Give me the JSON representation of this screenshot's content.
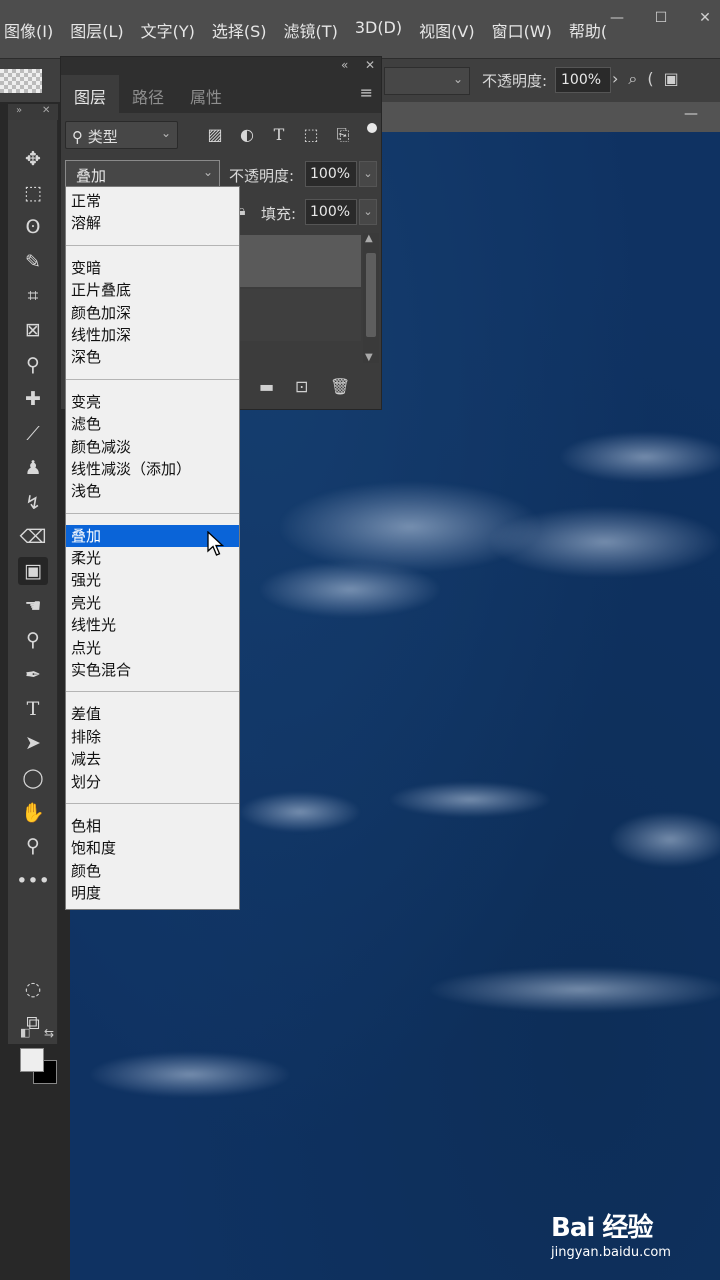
{
  "menubar": {
    "items": [
      "图像(I)",
      "图层(L)",
      "文字(Y)",
      "选择(S)",
      "滤镜(T)",
      "3D(D)",
      "视图(V)",
      "窗口(W)",
      "帮助("
    ],
    "window_controls": [
      "—",
      "☐",
      "✕"
    ]
  },
  "options_bar": {
    "opacity_label": "不透明度:",
    "opacity_value": "100%"
  },
  "layers_panel": {
    "tabs": [
      "图层",
      "路径",
      "属性"
    ],
    "filter_label": "类型",
    "blend_mode": "叠加",
    "opacity_label": "不透明度:",
    "opacity_value": "100%",
    "fill_label": "填充:",
    "fill_value": "100%"
  },
  "blend_modes": {
    "groups": [
      [
        "正常",
        "溶解"
      ],
      [
        "变暗",
        "正片叠底",
        "颜色加深",
        "线性加深",
        "深色"
      ],
      [
        "变亮",
        "滤色",
        "颜色减淡",
        "线性减淡（添加）",
        "浅色"
      ],
      [
        "叠加",
        "柔光",
        "强光",
        "亮光",
        "线性光",
        "点光",
        "实色混合"
      ],
      [
        "差值",
        "排除",
        "减去",
        "划分"
      ],
      [
        "色相",
        "饱和度",
        "颜色",
        "明度"
      ]
    ],
    "selected": "叠加"
  },
  "watermark": {
    "brand": "Bai 经验",
    "url": "jingyan.baidu.com"
  },
  "colors": {
    "canvas": "#0f3262",
    "selection": "#0a64d8",
    "foreground": "#eeeeee",
    "background": "#000000"
  }
}
